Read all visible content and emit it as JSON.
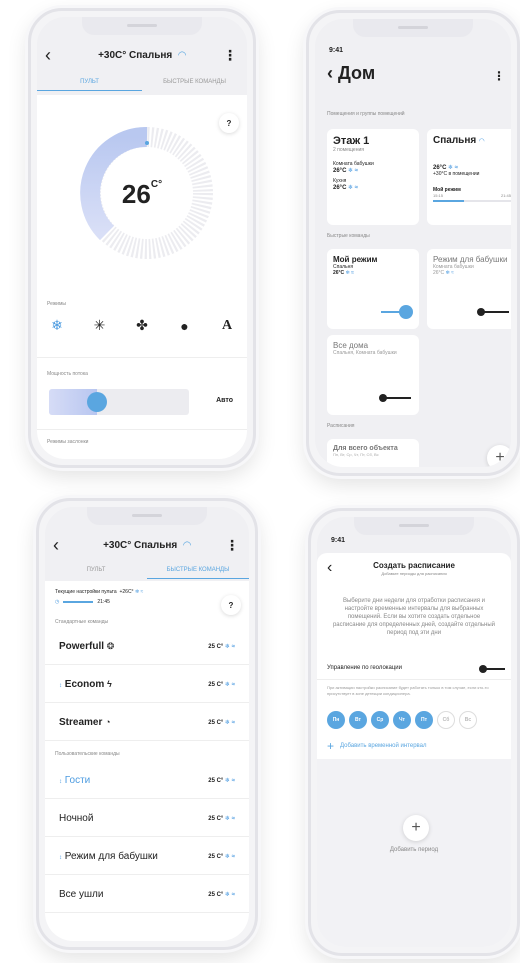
{
  "phone1": {
    "header_title": "+30C° Спальня",
    "tabs": [
      "ПУЛЬТ",
      "БЫСТРЫЕ КОМАНДЫ"
    ],
    "help": "?",
    "temperature": "26",
    "temp_unit": "C°",
    "modes_label": "Режимы",
    "modes": [
      "❄",
      "✳",
      "✤",
      "●",
      "A"
    ],
    "flow_label": "Мощность потока",
    "flow_auto": "Авто",
    "flaps_label": "Режимы заслонки"
  },
  "phone2": {
    "time": "9:41",
    "title": "Дом",
    "rooms_section": "Помещения и группы помещений",
    "floor_card": {
      "title": "Этаж 1",
      "sub": "2 помещения",
      "room1": "Комната бабушки",
      "room1_val": "26°C",
      "room2": "Кухня",
      "room2_val": "26°C"
    },
    "bedroom_card": {
      "title": "Спальня",
      "temp": "26°C",
      "inside": "+30°C в помещении",
      "mode": "Мой режим",
      "start": "15:15",
      "end": "21:45"
    },
    "quick_section": "Быстрые команды",
    "my_mode": {
      "title": "Мой режим",
      "room": "Спальня",
      "temp": "26°C"
    },
    "granny_mode": {
      "title": "Режим для бабушки",
      "room": "Комната бабушки",
      "temp": "26°C"
    },
    "all_home": {
      "title": "Все дома",
      "rooms": "Спальня, Комната бабушки"
    },
    "schedule_section": "Расписания",
    "schedule_card": {
      "title": "Для всего объекта",
      "days": "Пн, Вт, Ср, Чт, Пт, Сб, Вс"
    }
  },
  "phone3": {
    "header_title": "+30C° Спальня",
    "tabs": [
      "ПУЛЬТ",
      "БЫСТРЫЕ КОМАНДЫ"
    ],
    "current_label": "Текущие настройки пульта",
    "current_val": "+26C°",
    "current_time": "21:45",
    "standard_label": "Стандартные команды",
    "standard": [
      {
        "name": "Powerfull",
        "val": "25 C°"
      },
      {
        "name": "Econom",
        "val": "25 C°"
      },
      {
        "name": "Streamer",
        "val": "25 C°"
      }
    ],
    "custom_label": "Пользовательские команды",
    "custom": [
      {
        "name": "Гости",
        "val": "25 C°"
      },
      {
        "name": "Ночной",
        "val": "25 C°"
      },
      {
        "name": "Режим для бабушки",
        "val": "25 C°"
      },
      {
        "name": "Все ушли",
        "val": "25 C°"
      }
    ]
  },
  "phone4": {
    "time": "9:41",
    "title": "Создать расписание",
    "subtitle": "Добавьте периоды для расписания",
    "description": "Выберите дни недели для отработки расписания и настройте временные интервалы для выбранных помещений. Если вы хотите создать отдельное расписание для определенных дней, создайте отдельный период под эти дни",
    "geo_label": "Управление по геолокации",
    "geo_note": "При активации настройки расписание будет работать только в том случае, если кто-то присутствует в зоне детекции кондиционера.",
    "days": [
      "Пн",
      "Вт",
      "Ср",
      "Чт",
      "Пт",
      "Сб",
      "Вс"
    ],
    "add_interval": "Добавить временной интервал",
    "add_period": "Добавить период"
  }
}
